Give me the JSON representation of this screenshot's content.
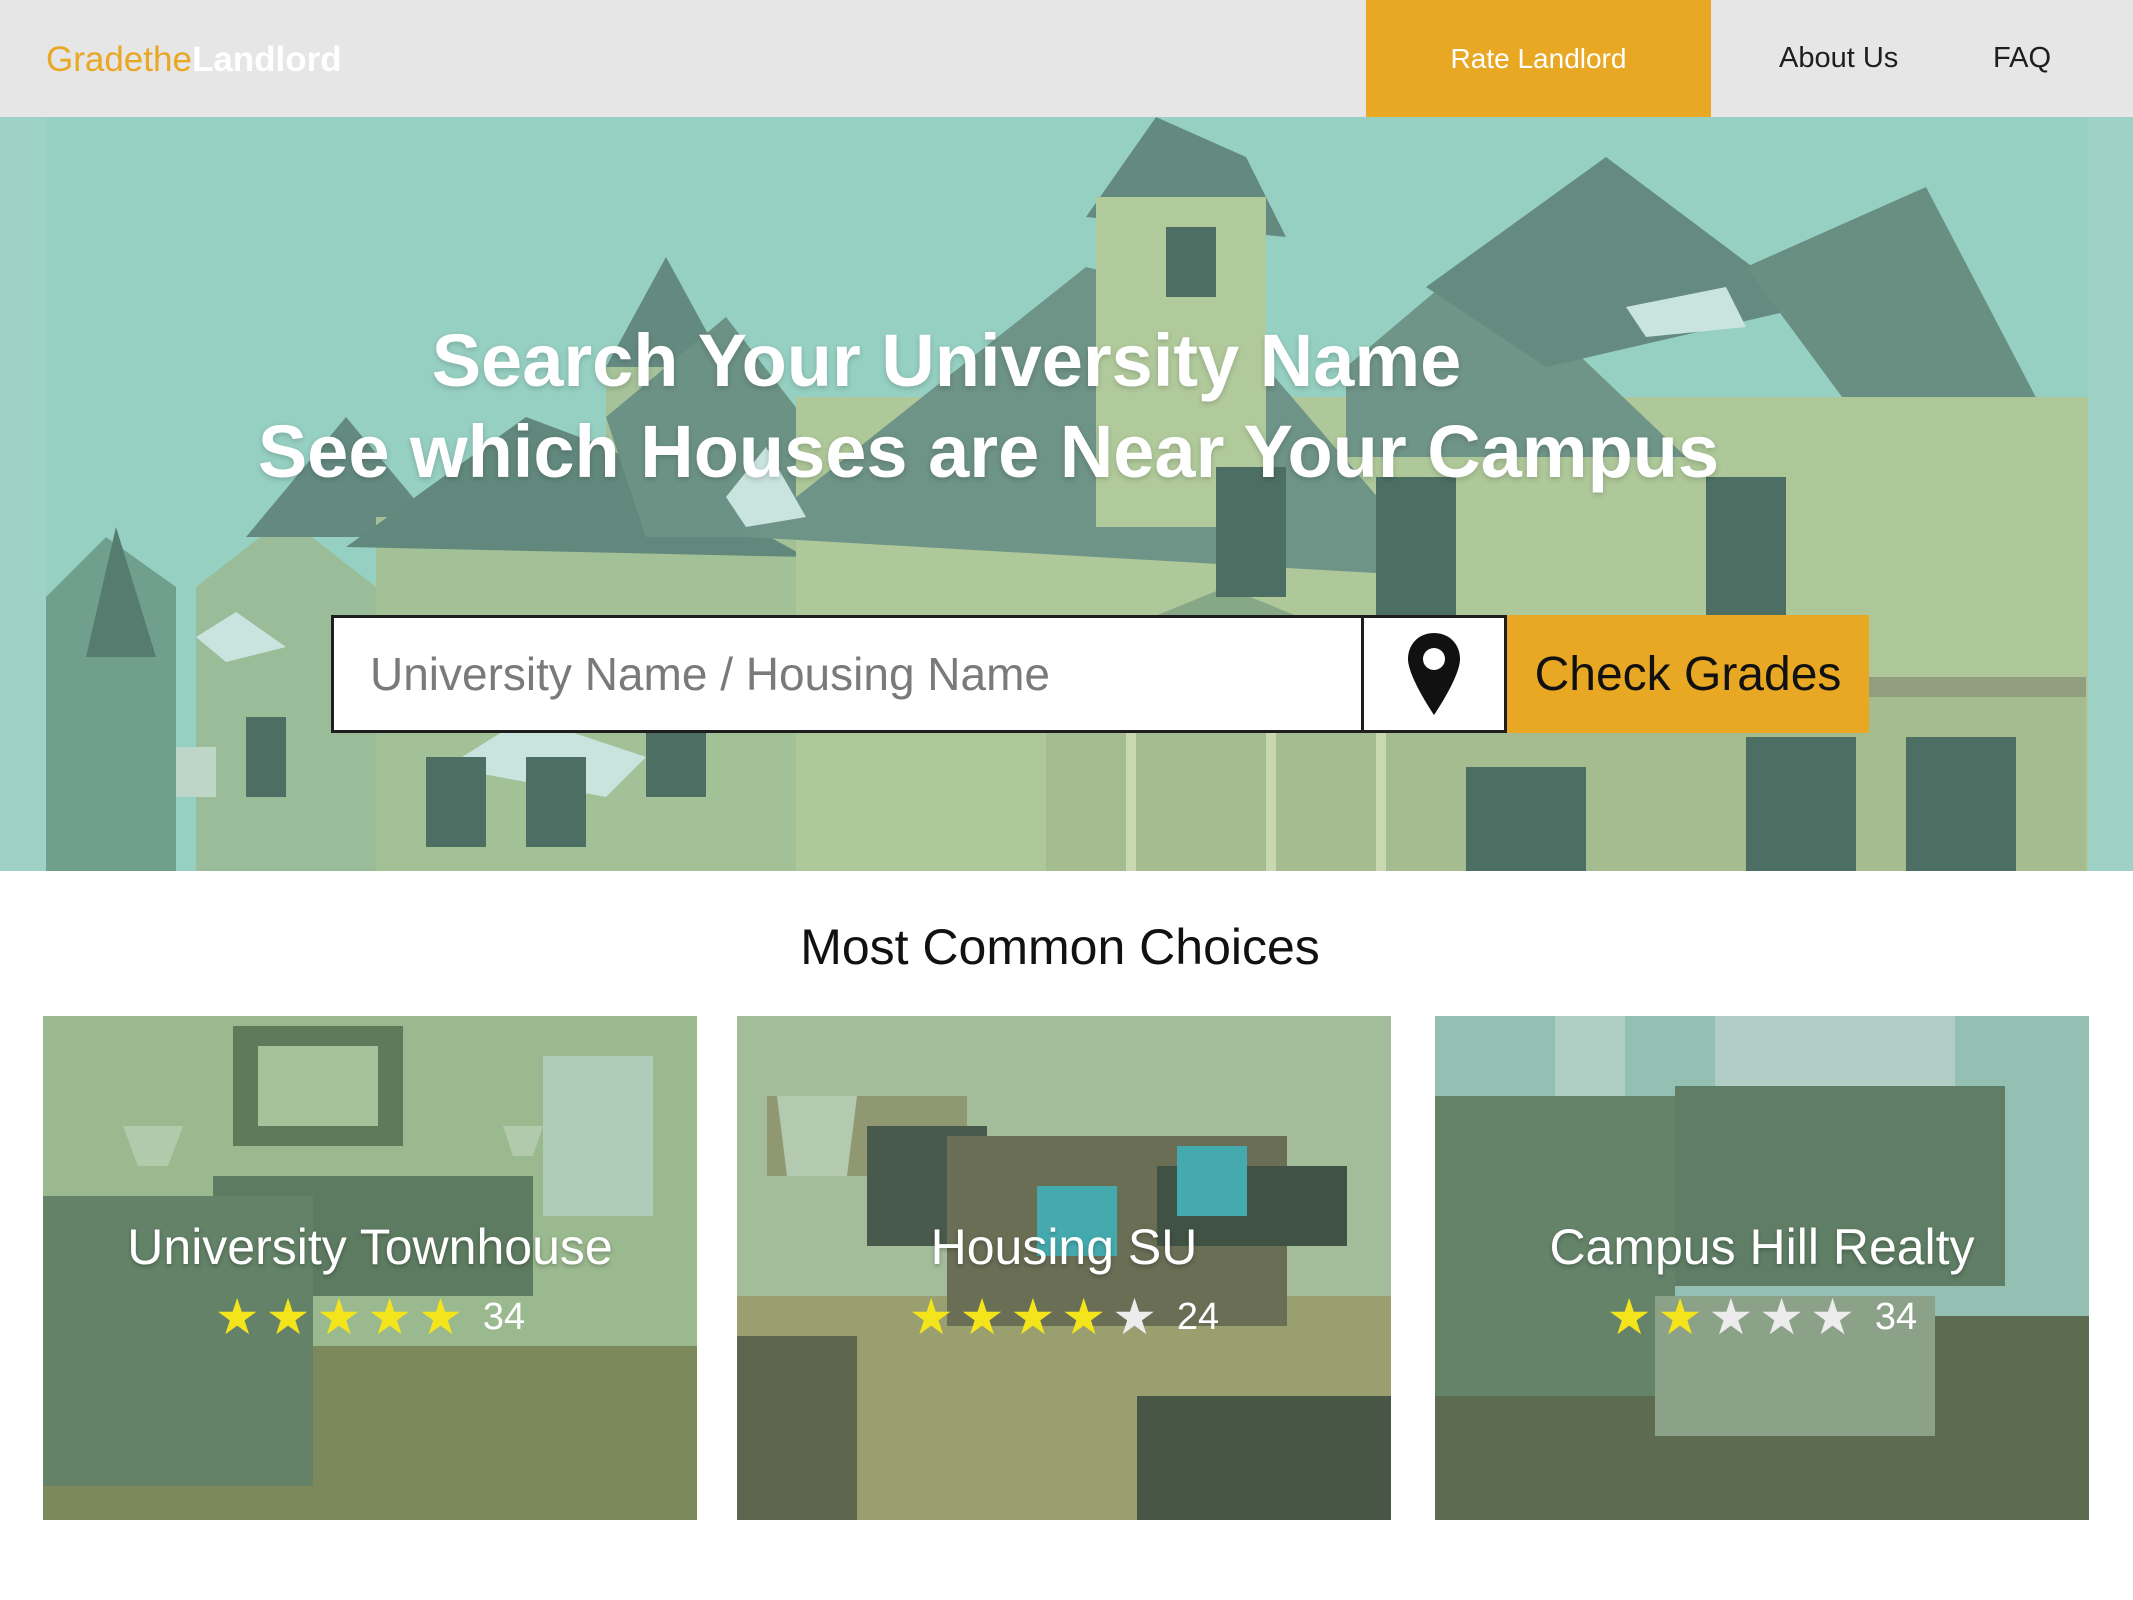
{
  "nav": {
    "logo_part1": "Gradethe",
    "logo_part2": "Landlord",
    "cta_label": "Rate Landlord",
    "links": [
      "About Us",
      "FAQ"
    ]
  },
  "hero": {
    "title_line1": "Search Your University Name",
    "title_line2": "See which Houses are Near Your Campus",
    "search_placeholder": "University Name / Housing Name",
    "location_icon": "map-pin-icon",
    "button_label": "Check Grades"
  },
  "section": {
    "title": "Most Common Choices"
  },
  "cards": [
    {
      "name": "University Townhouse",
      "rating": 5,
      "max_rating": 5,
      "count": "34"
    },
    {
      "name": "Housing SU",
      "rating": 4,
      "max_rating": 5,
      "count": "24"
    },
    {
      "name": "Campus Hill Realty",
      "rating": 2,
      "max_rating": 5,
      "count": "34"
    }
  ],
  "colors": {
    "accent": "#e8a823",
    "nav_bg": "#e6e6e6",
    "hero_tint": "#9fd2c6",
    "star_on": "#f4e41c",
    "star_off": "#ececec"
  }
}
